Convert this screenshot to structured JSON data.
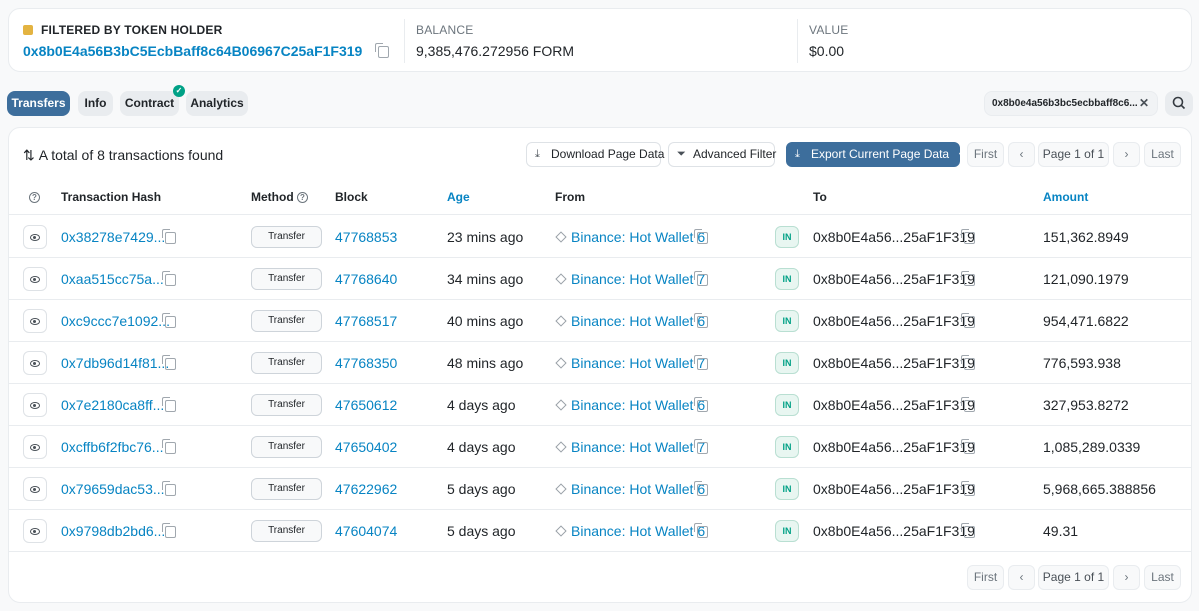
{
  "header": {
    "filter_label": "FILTERED BY TOKEN HOLDER",
    "holder_address": "0x8b0E4a56B3bC5EcbBaff8c64B06967C25aF1F319",
    "balance_label": "BALANCE",
    "balance_value": "9,385,476.272956 FORM",
    "value_label": "VALUE",
    "value_value": "$0.00"
  },
  "tabs": [
    {
      "label": "Transfers",
      "active": true
    },
    {
      "label": "Info"
    },
    {
      "label": "Contract",
      "verified": true
    },
    {
      "label": "Analytics"
    }
  ],
  "filter_chip": {
    "text": "0x8b0e4a56b3bc5ecbbaff8c6..."
  },
  "toolbar": {
    "summary": "A total of 8 transactions found",
    "download_label": "Download Page Data",
    "advanced_filter_label": "Advanced Filter",
    "export_label": "Export Current Page Data"
  },
  "pagination": {
    "first": "First",
    "page_text": "Page 1 of 1",
    "last": "Last"
  },
  "columns": {
    "txhash": "Transaction Hash",
    "method": "Method",
    "block": "Block",
    "age": "Age",
    "from": "From",
    "to": "To",
    "amount": "Amount"
  },
  "colors": {
    "link": "#0784c3",
    "primary": "#3d6e9c",
    "in_badge": "#00a186"
  },
  "rows": [
    {
      "hash": "0x38278e7429...",
      "method": "Transfer",
      "block": "47768853",
      "age": "23 mins ago",
      "from": "Binance: Hot Wallet 6",
      "direction": "IN",
      "to": "0x8b0E4a56...25aF1F319",
      "amount": "151,362.8949"
    },
    {
      "hash": "0xaa515cc75a...",
      "method": "Transfer",
      "block": "47768640",
      "age": "34 mins ago",
      "from": "Binance: Hot Wallet 7",
      "direction": "IN",
      "to": "0x8b0E4a56...25aF1F319",
      "amount": "121,090.1979"
    },
    {
      "hash": "0xc9ccc7e1092...",
      "method": "Transfer",
      "block": "47768517",
      "age": "40 mins ago",
      "from": "Binance: Hot Wallet 6",
      "direction": "IN",
      "to": "0x8b0E4a56...25aF1F319",
      "amount": "954,471.6822"
    },
    {
      "hash": "0x7db96d14f81...",
      "method": "Transfer",
      "block": "47768350",
      "age": "48 mins ago",
      "from": "Binance: Hot Wallet 7",
      "direction": "IN",
      "to": "0x8b0E4a56...25aF1F319",
      "amount": "776,593.938"
    },
    {
      "hash": "0x7e2180ca8ff...",
      "method": "Transfer",
      "block": "47650612",
      "age": "4 days ago",
      "from": "Binance: Hot Wallet 6",
      "direction": "IN",
      "to": "0x8b0E4a56...25aF1F319",
      "amount": "327,953.8272"
    },
    {
      "hash": "0xcffb6f2fbc76...",
      "method": "Transfer",
      "block": "47650402",
      "age": "4 days ago",
      "from": "Binance: Hot Wallet 7",
      "direction": "IN",
      "to": "0x8b0E4a56...25aF1F319",
      "amount": "1,085,289.0339"
    },
    {
      "hash": "0x79659dac53...",
      "method": "Transfer",
      "block": "47622962",
      "age": "5 days ago",
      "from": "Binance: Hot Wallet 6",
      "direction": "IN",
      "to": "0x8b0E4a56...25aF1F319",
      "amount": "5,968,665.388856"
    },
    {
      "hash": "0x9798db2bd6...",
      "method": "Transfer",
      "block": "47604074",
      "age": "5 days ago",
      "from": "Binance: Hot Wallet 6",
      "direction": "IN",
      "to": "0x8b0E4a56...25aF1F319",
      "amount": "49.31"
    }
  ]
}
